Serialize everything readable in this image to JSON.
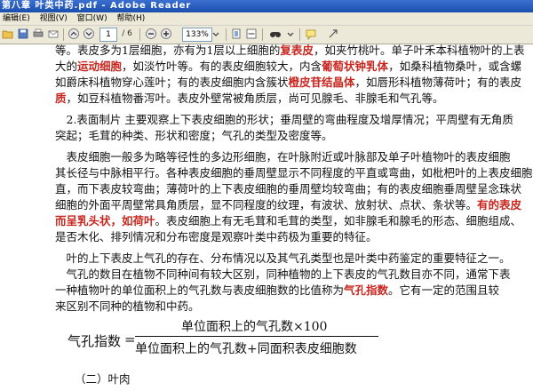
{
  "window": {
    "title": "第八章 叶类中药.pdf - Adobe Reader"
  },
  "menu": [
    "编辑(E)",
    "视图(V)",
    "窗口(W)",
    "帮助(H)"
  ],
  "toolbar": {
    "page_current": "1",
    "page_total": "/ 6",
    "zoom": "133%"
  },
  "lines": [
    [
      {
        "t": "等。表皮多为1层细胞，亦有为1层以上细胞的"
      },
      {
        "t": "复表皮",
        "r": 1
      },
      {
        "t": "，如夹竹桃叶。单子叶禾本科植物叶的上表"
      }
    ],
    [
      {
        "t": "大的"
      },
      {
        "t": "运动细胞",
        "r": 1
      },
      {
        "t": "，如淡竹叶等。有的表皮细胞较大，内含"
      },
      {
        "t": "葡萄状钟乳体",
        "r": 1
      },
      {
        "t": "，如桑科植物桑叶，或含螺"
      }
    ],
    [
      {
        "t": "如爵床科植物穿心莲叶；有的表皮细胞内含簇状"
      },
      {
        "t": "橙皮苷结晶体",
        "r": 1
      },
      {
        "t": "，如唇形科植物薄荷叶；有的表皮"
      }
    ],
    [
      {
        "t": "质",
        "r": 1
      },
      {
        "t": "，如豆科植物番泻叶。表皮外壁常被角质层，尚可见腺毛、非腺毛和气孔等。"
      }
    ],
    [
      {
        "t": "　2.表面制片  主要观察上下表皮细胞的形状；垂周壁的弯曲程度及增厚情况；平周壁有无角质"
      }
    ],
    [
      {
        "t": "突起；毛茸的种类、形状和密度；气孔的类型及密度等。"
      }
    ],
    [
      {
        "t": "　表皮细胞一般多为略等径性的多边形细胞，在叶脉附近或叶脉部及单子叶植物叶的表皮细胞"
      }
    ],
    [
      {
        "t": "其长径与中脉相平行。各种表皮细胞的垂周壁显示不同程度的平直或弯曲，如枇杷叶的上表皮细胞"
      }
    ],
    [
      {
        "t": "直，而下表皮较弯曲；薄荷叶的上下表皮细胞的垂周壁均较弯曲；有的表皮细胞垂周壁呈念珠状"
      }
    ],
    [
      {
        "t": "细胞的外面平周壁常具角质层，显不同程度的纹理，有波状、放射状、点状、条状等。"
      },
      {
        "t": "有的表皮",
        "r": 1
      }
    ],
    [
      {
        "t": "而呈乳头状，如荷叶",
        "r": 1
      },
      {
        "t": "。表皮细胞上有无毛茸和毛茸的类型，如非腺毛和腺毛的形态、细胞组成、"
      }
    ],
    [
      {
        "t": "是否木化、排列情况和分布密度是观察叶类中药极为重要的特征。"
      }
    ],
    [
      {
        "t": "　叶的上下表皮上气孔的存在、分布情况以及其气孔类型也是叶类中药鉴定的重要特征之一。"
      }
    ],
    [
      {
        "t": "　气孔的数目在植物不同种间有较大区别，同种植物的上下表皮的气孔数目亦不同，通常下表"
      }
    ],
    [
      {
        "t": "一种植物叶的单位面积上的气孔数与表皮细胞数的比值称为"
      },
      {
        "t": "气孔指数",
        "r": 1
      },
      {
        "t": "。它有一定的范围且较"
      }
    ],
    [
      {
        "t": "来区别不同种的植物和中药。"
      }
    ]
  ],
  "formula": {
    "label": "气孔指数",
    "eq": "=",
    "numerator": "单位面积上的气孔数×100",
    "denominator": "单位面积上的气孔数+同面积表皮细胞数"
  },
  "section": "（二）叶肉",
  "colors": {
    "highlight": "#c8261e",
    "titlebar": "#1b4fae"
  }
}
